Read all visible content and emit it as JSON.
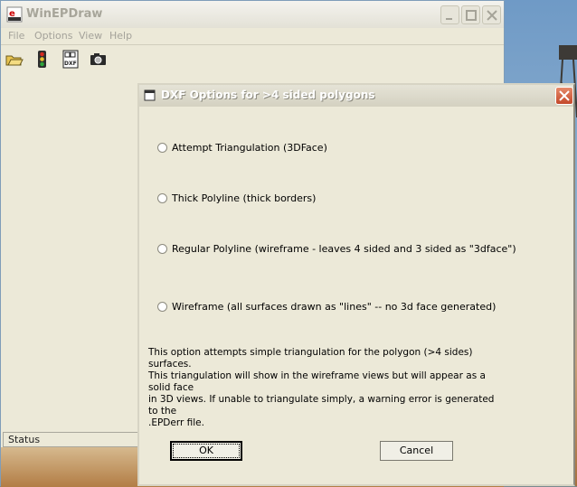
{
  "main_window": {
    "title": "WinEPDraw",
    "menu": [
      "File",
      "Options",
      "View",
      "Help"
    ],
    "toolbar_icons": [
      "open-folder-icon",
      "traffic-light-icon",
      "dxf-export-icon",
      "camera-icon"
    ],
    "status": "Status"
  },
  "dialog": {
    "title": "DXF Options for >4 sided polygons",
    "options": [
      "Attempt Triangulation (3DFace)",
      "Thick Polyline (thick borders)",
      "Regular Polyline (wireframe - leaves 4 sided and 3 sided as \"3dface\")",
      "Wireframe (all surfaces drawn as \"lines\" -- no 3d face generated)"
    ],
    "description_lines": [
      "This option attempts simple triangulation for the polygon (>4 sides) surfaces.",
      "This triangulation will show in the wireframe views but will appear as a solid face",
      "in 3D views.  If unable to triangulate simply, a warning error is generated to the",
      ".EPDerr file."
    ],
    "ok_label": "OK",
    "cancel_label": "Cancel"
  },
  "colors": {
    "window_bg": "#ece9d8",
    "close_button": "#c3482a",
    "dialog_title_text": "#ffffff"
  }
}
